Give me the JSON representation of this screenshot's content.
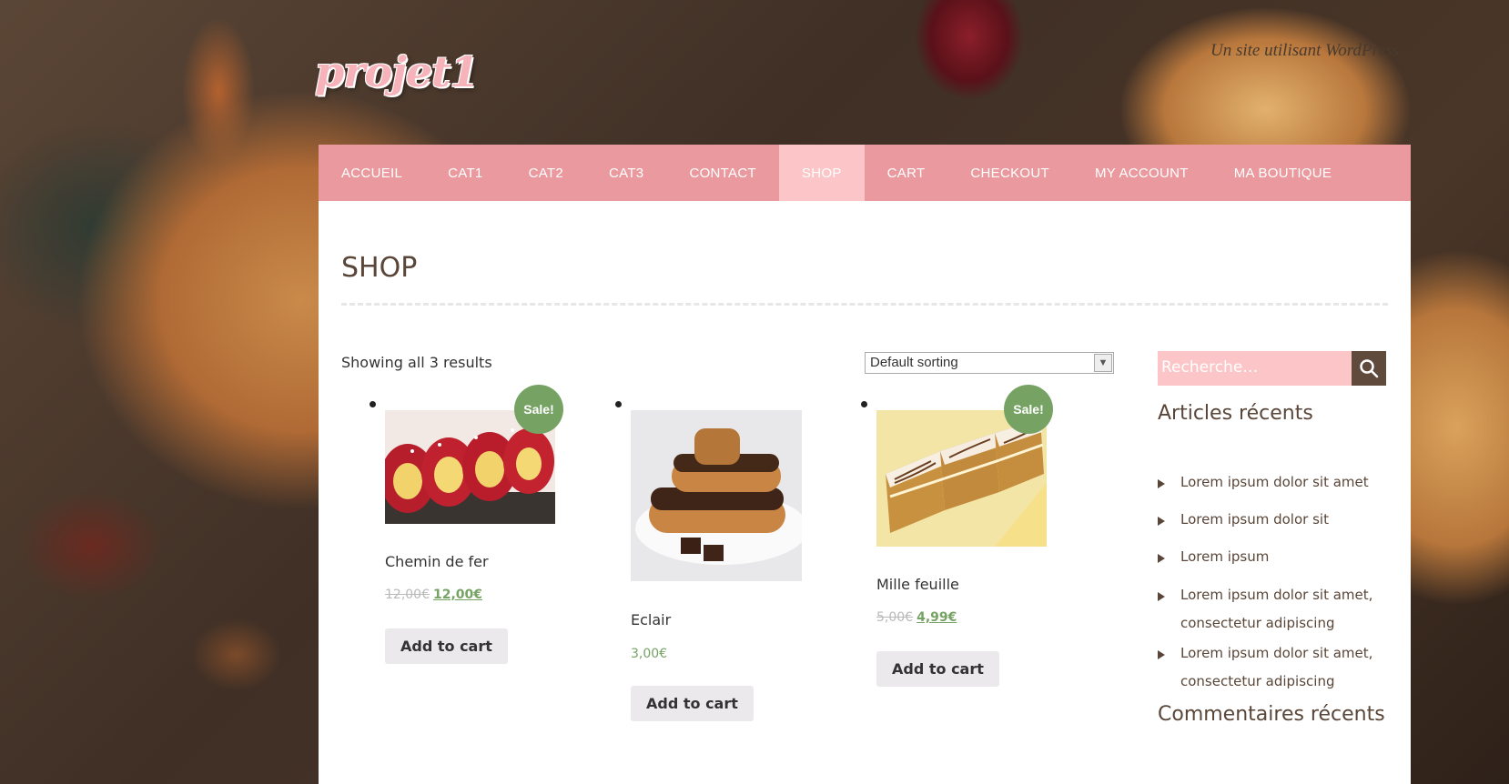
{
  "site": {
    "title": "projet1",
    "tagline": "Un site utilisant WordPress"
  },
  "nav": {
    "items": [
      {
        "label": "ACCUEIL"
      },
      {
        "label": "CAT1"
      },
      {
        "label": "CAT2"
      },
      {
        "label": "CAT3"
      },
      {
        "label": "CONTACT"
      },
      {
        "label": "SHOP",
        "active": true
      },
      {
        "label": "CART"
      },
      {
        "label": "CHECKOUT"
      },
      {
        "label": "MY ACCOUNT"
      },
      {
        "label": "MA BOUTIQUE"
      }
    ]
  },
  "page": {
    "title": "SHOP",
    "result_count": "Showing all 3 results",
    "sorting": {
      "selected": "Default sorting"
    }
  },
  "products": [
    {
      "name": "Chemin de fer",
      "sale_badge": "Sale!",
      "old_price": "12,00€",
      "price": "12,00€",
      "button": "Add to cart"
    },
    {
      "name": "Eclair",
      "price": "3,00€",
      "button": "Add to cart"
    },
    {
      "name": "Mille feuille",
      "sale_badge": "Sale!",
      "old_price": "5,00€",
      "price": "4,99€",
      "button": "Add to cart"
    }
  ],
  "sidebar": {
    "search_placeholder": "Recherche…",
    "recent_posts_title": "Articles récents",
    "recent_posts": [
      "Lorem ipsum dolor sit amet",
      "Lorem ipsum dolor sit",
      "Lorem ipsum",
      "Lorem ipsum dolor sit amet, consectetur adipiscing",
      "Lorem ipsum dolor sit amet, consectetur adipiscing"
    ],
    "recent_comments_title": "Commentaires récents"
  },
  "colors": {
    "nav_bg": "#ea9a9e",
    "nav_active": "#fcc5c7",
    "sale_badge": "#76a364",
    "price_green": "#76a364",
    "search_bg": "#fcc5c7",
    "search_button": "#5f4a3c"
  }
}
